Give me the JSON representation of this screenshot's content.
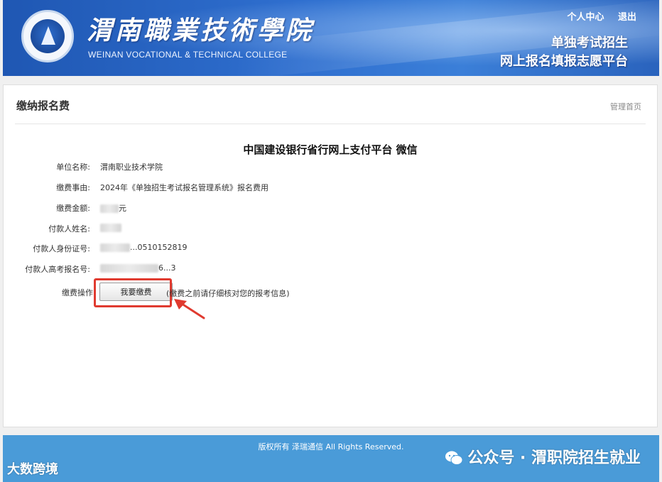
{
  "header": {
    "college_cn": "渭南職業技術學院",
    "college_en": "WEINAN VOCATIONAL & TECHNICAL COLLEGE",
    "links": [
      "个人中心",
      "退出"
    ],
    "platform_line1": "单独考试招生",
    "platform_line2": "网上报名填报志愿平台"
  },
  "panel": {
    "title": "缴纳报名费",
    "home_link": "管理首页",
    "pay_title": "中国建设银行省行网上支付平台 微信",
    "rows": [
      {
        "label": "单位名称:",
        "value": "渭南职业技术学院"
      },
      {
        "label": "缴费事由:",
        "value": "2024年《单独招生考试报名管理系统》报名费用"
      },
      {
        "label": "缴费金额:",
        "value": "元"
      },
      {
        "label": "付款人姓名:",
        "value": ""
      },
      {
        "label": "付款人身份证号:",
        "value": "...0510152819"
      },
      {
        "label": "付款人高考报名号:",
        "value": "6...3"
      },
      {
        "label": "缴费操作",
        "value": ""
      }
    ],
    "pay_button": "我要缴费",
    "pay_note": "(缴费之前请仔细核对您的报考信息)"
  },
  "footer": {
    "copyright": "版权所有 泽瑞通信 All Rights Reserved.",
    "watermark_left": "大数跨境",
    "watermark_right": "公众号 · 渭职院招生就业"
  },
  "colors": {
    "header_blue": "#2f6fcf",
    "footer_blue": "#4a9bd8",
    "highlight_red": "#e03a2f"
  }
}
